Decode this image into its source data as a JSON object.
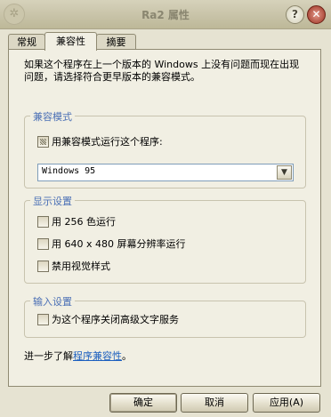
{
  "window": {
    "title": "Ra2 属性",
    "help_label": "?",
    "close_label": "✕",
    "ornament": "✲"
  },
  "tabs": [
    {
      "label": "常规",
      "active": false
    },
    {
      "label": "兼容性",
      "active": true
    },
    {
      "label": "摘要",
      "active": false
    }
  ],
  "compat": {
    "description": "如果这个程序在上一个版本的 Windows 上没有问题而现在出现问题，请选择符合更早版本的兼容模式。",
    "mode_group": {
      "title": "兼容模式",
      "checkbox_label": "用兼容模式运行这个程序:",
      "select_value": "Windows 95",
      "select_arrow": "▼"
    },
    "display_group": {
      "title": "显示设置",
      "options": [
        "用 256 色运行",
        "用 640 x 480 屏幕分辨率运行",
        "禁用视觉样式"
      ]
    },
    "input_group": {
      "title": "输入设置",
      "option": "为这个程序关闭高级文字服务"
    },
    "learn_more": {
      "prefix": "进一步了解",
      "link": "程序兼容性",
      "suffix": "。"
    }
  },
  "buttons": {
    "ok": "确定",
    "cancel": "取消",
    "apply": "应用(A)"
  }
}
